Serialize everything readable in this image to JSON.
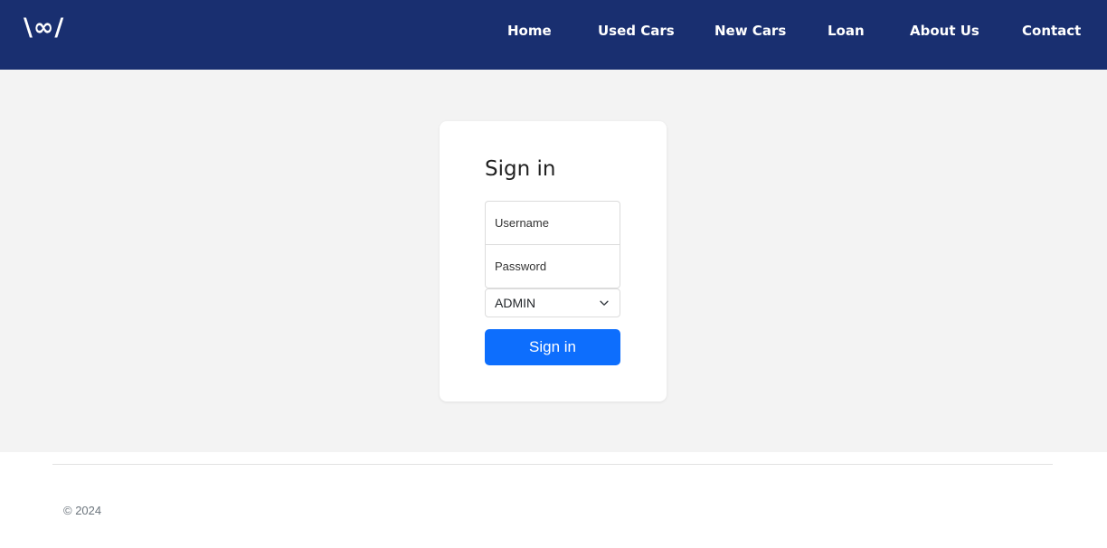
{
  "brand": {
    "logo_text": "\\∞/"
  },
  "nav": {
    "items": [
      {
        "label": "Home"
      },
      {
        "label": "Used Cars"
      },
      {
        "label": "New Cars"
      },
      {
        "label": "Loan"
      },
      {
        "label": "About Us"
      },
      {
        "label": "Contact"
      }
    ]
  },
  "login": {
    "title": "Sign in",
    "username": {
      "placeholder": "Username",
      "value": ""
    },
    "password": {
      "placeholder": "Password",
      "value": ""
    },
    "role": {
      "selected": "ADMIN",
      "icon": "chevron-down-icon"
    },
    "submit_label": "Sign in"
  },
  "footer": {
    "copyright": "© 2024"
  },
  "colors": {
    "navbar": "#192f70",
    "page_background": "#f3f3f3",
    "primary_button": "#0d6efd",
    "card": "#ffffff"
  }
}
